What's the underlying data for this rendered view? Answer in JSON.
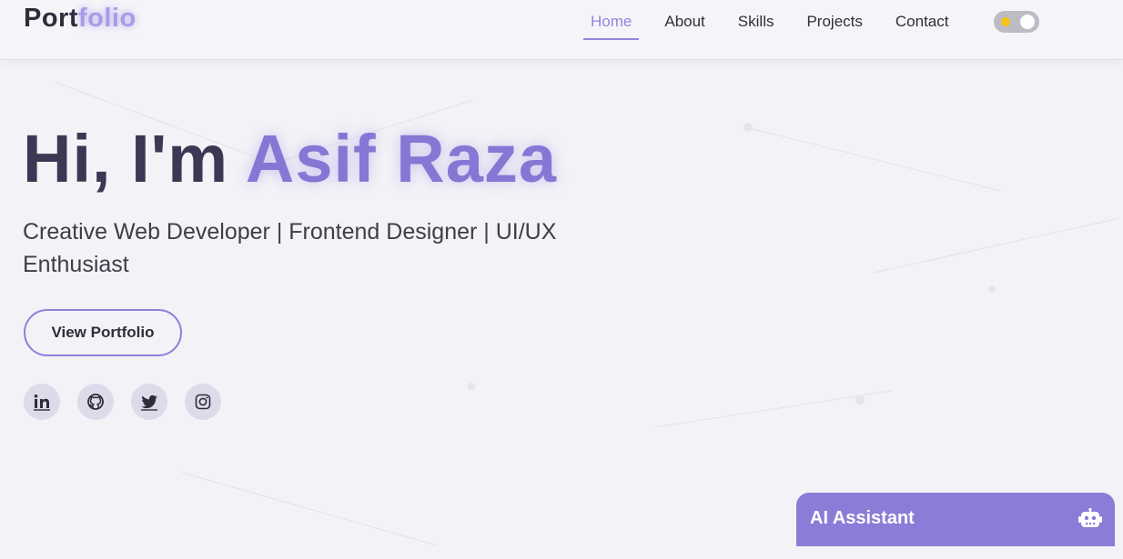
{
  "header": {
    "logo_part1": "Port",
    "logo_part2": "folio",
    "nav": [
      {
        "label": "Home",
        "active": true
      },
      {
        "label": "About",
        "active": false
      },
      {
        "label": "Skills",
        "active": false
      },
      {
        "label": "Projects",
        "active": false
      },
      {
        "label": "Contact",
        "active": false
      }
    ],
    "theme_toggle": {
      "icons": [
        "sun-icon",
        "moon-icon"
      ]
    }
  },
  "hero": {
    "greeting": "Hi, I'm ",
    "name": "Asif Raza",
    "subtitle": "Creative Web Developer | Frontend Designer | UI/UX Enthusiast",
    "cta_label": "View Portfolio",
    "socials": [
      "linkedin-icon",
      "github-icon",
      "twitter-icon",
      "instagram-icon"
    ]
  },
  "assistant": {
    "label": "AI Assistant",
    "icon": "robot-icon"
  },
  "colors": {
    "accent": "#8a7dd7",
    "background": "#f3f2f6",
    "text": "#2f2d3a"
  }
}
